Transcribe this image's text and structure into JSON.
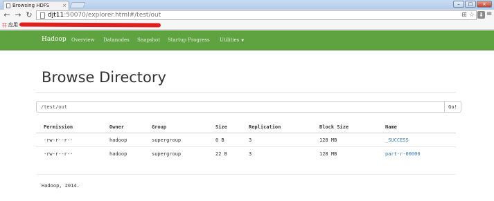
{
  "browser": {
    "tab_title": "Browsing HDFS",
    "tab_close": "×",
    "window_controls": [
      "–",
      "□",
      "×"
    ],
    "url_host": "djt11",
    "url_rest": ":50070/explorer.html#/test/out",
    "bookmark_label": "应用"
  },
  "navbar": {
    "brand": "Hadoop",
    "items": [
      "Overview",
      "Datanodes",
      "Snapshot",
      "Startup Progress",
      "Utilities"
    ],
    "accent_color": "#5fa341"
  },
  "page": {
    "title": "Browse Directory",
    "directory_value": "/test/out",
    "go_label": "Go!"
  },
  "table": {
    "headers": [
      "Permission",
      "Owner",
      "Group",
      "Size",
      "Replication",
      "Block Size",
      "Name"
    ],
    "rows": [
      [
        "-rw-r--r--",
        "hadoop",
        "supergroup",
        "0 B",
        "3",
        "128 MB",
        "_SUCCESS"
      ],
      [
        "-rw-r--r--",
        "hadoop",
        "supergroup",
        "22 B",
        "3",
        "128 MB",
        "part-r-00000"
      ]
    ]
  },
  "footer": "Hadoop, 2014."
}
